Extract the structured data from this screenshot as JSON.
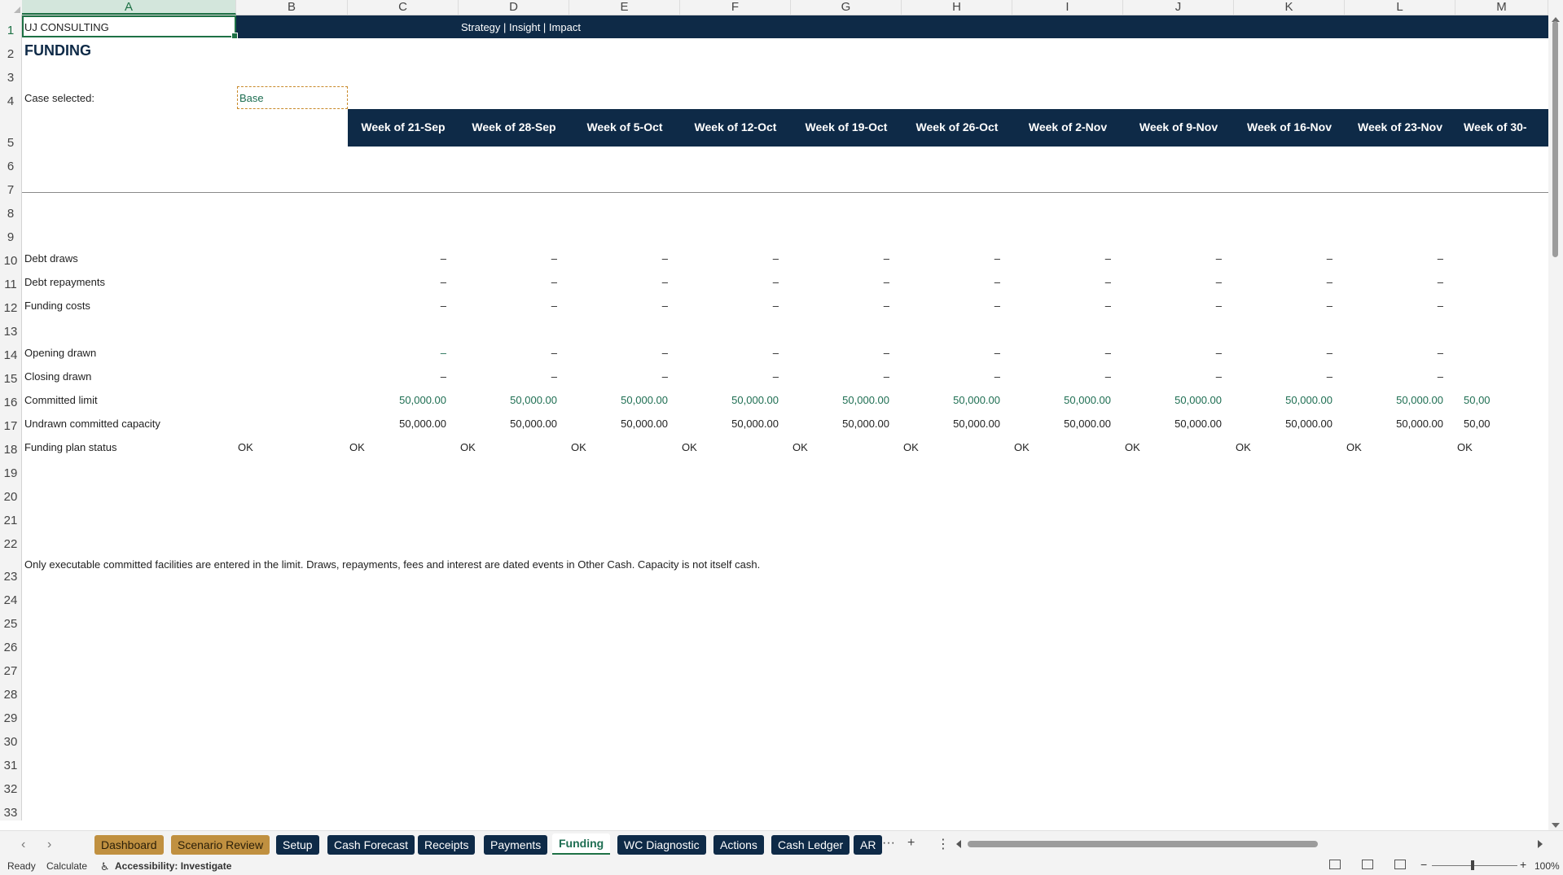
{
  "columns": [
    "A",
    "B",
    "C",
    "D",
    "E",
    "F",
    "G",
    "H",
    "I",
    "J",
    "K",
    "L",
    "M"
  ],
  "rows": [
    "1",
    "2",
    "3",
    "4",
    "5",
    "6",
    "7",
    "8",
    "9",
    "10",
    "11",
    "12",
    "13",
    "14",
    "15",
    "16",
    "17",
    "18",
    "19",
    "20",
    "21",
    "22",
    "23",
    "24",
    "25",
    "26",
    "27",
    "28",
    "29",
    "30",
    "31",
    "32",
    "33"
  ],
  "sheet": {
    "company": "UJ CONSULTING",
    "tagline": "Strategy | Insight | Impact",
    "title": "FUNDING",
    "case_label": "Case selected:",
    "case_value": "Base",
    "weeks": [
      "Week of 21-Sep",
      "Week of 28-Sep",
      "Week of 5-Oct",
      "Week of 12-Oct",
      "Week of 19-Oct",
      "Week of 26-Oct",
      "Week of 2-Nov",
      "Week of 9-Nov",
      "Week of 16-Nov",
      "Week of 23-Nov",
      "Week of 30-"
    ],
    "line_items": [
      {
        "label": "Debt draws",
        "values": [
          "–",
          "–",
          "–",
          "–",
          "–",
          "–",
          "–",
          "–",
          "–",
          "–"
        ]
      },
      {
        "label": "Debt repayments",
        "values": [
          "–",
          "–",
          "–",
          "–",
          "–",
          "–",
          "–",
          "–",
          "–",
          "–"
        ]
      },
      {
        "label": "Funding costs",
        "values": [
          "–",
          "–",
          "–",
          "–",
          "–",
          "–",
          "–",
          "–",
          "–",
          "–"
        ]
      },
      {
        "label": "Opening drawn",
        "values": [
          "–",
          "–",
          "–",
          "–",
          "–",
          "–",
          "–",
          "–",
          "–",
          "–"
        ]
      },
      {
        "label": "Closing drawn",
        "values": [
          "–",
          "–",
          "–",
          "–",
          "–",
          "–",
          "–",
          "–",
          "–",
          "–"
        ]
      },
      {
        "label": "Committed limit",
        "values": [
          "50,000.00",
          "50,000.00",
          "50,000.00",
          "50,000.00",
          "50,000.00",
          "50,000.00",
          "50,000.00",
          "50,000.00",
          "50,000.00",
          "50,000.00",
          "50,00"
        ]
      },
      {
        "label": "Undrawn committed capacity",
        "values": [
          "50,000.00",
          "50,000.00",
          "50,000.00",
          "50,000.00",
          "50,000.00",
          "50,000.00",
          "50,000.00",
          "50,000.00",
          "50,000.00",
          "50,000.00",
          "50,00"
        ]
      },
      {
        "label": "Funding plan status",
        "values": [
          "OK",
          "OK",
          "OK",
          "OK",
          "OK",
          "OK",
          "OK",
          "OK",
          "OK",
          "OK",
          "OK",
          "OK"
        ]
      }
    ],
    "footnote": "Only executable committed facilities are entered in the limit. Draws, repayments, fees and interest are dated events in Other Cash. Capacity is not itself cash."
  },
  "tabs": [
    {
      "label": "Dashboard",
      "style": "gold"
    },
    {
      "label": "Scenario Review",
      "style": "gold"
    },
    {
      "label": "Setup",
      "style": "navy"
    },
    {
      "label": "Cash Forecast",
      "style": "navy"
    },
    {
      "label": "Receipts",
      "style": "navy"
    },
    {
      "label": "Payments",
      "style": "navy"
    },
    {
      "label": "Funding",
      "style": "active"
    },
    {
      "label": "WC Diagnostic",
      "style": "navy"
    },
    {
      "label": "Actions",
      "style": "navy"
    },
    {
      "label": "Cash Ledger",
      "style": "navy"
    },
    {
      "label": "AR",
      "style": "navy"
    }
  ],
  "tab_tools": {
    "more": "···",
    "add": "+",
    "options": "⋮"
  },
  "status": {
    "ready": "Ready",
    "calculate": "Calculate",
    "accessibility": "Accessibility: Investigate",
    "zoom_minus": "−",
    "zoom_plus": "+",
    "zoom": "100%"
  },
  "colors": {
    "navy": "#0e2a47",
    "green": "#1e6e52",
    "gold": "#c09040"
  },
  "icons": {
    "accessibility": "accessibility-icon",
    "normal_view": "grid-icon",
    "page_layout": "page-layout-icon",
    "page_break": "page-break-icon"
  }
}
